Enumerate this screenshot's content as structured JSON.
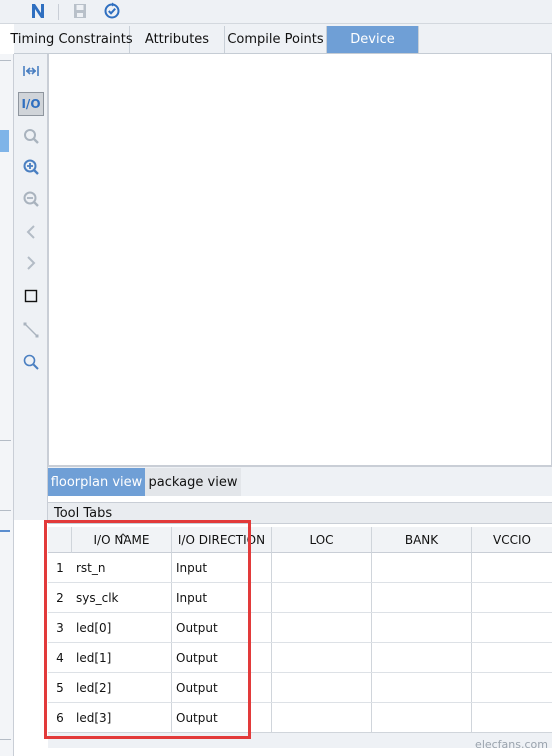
{
  "toolbar": {
    "buttons": [
      {
        "icon": "n-logo-icon"
      },
      {
        "icon": "save-icon"
      },
      {
        "icon": "check-refresh-icon"
      }
    ]
  },
  "tabs": [
    {
      "label": "Timing Constraints",
      "active": false
    },
    {
      "label": "Attributes",
      "active": false
    },
    {
      "label": "Compile Points",
      "active": false
    },
    {
      "label": "Device",
      "active": true
    }
  ],
  "vtoolbar": {
    "items": [
      {
        "icon": "fit-width-icon"
      },
      {
        "icon": "io-icon",
        "label": "I/O",
        "pressed": true
      },
      {
        "icon": "zoom-area-icon"
      },
      {
        "icon": "zoom-in-icon"
      },
      {
        "icon": "zoom-out-icon"
      },
      {
        "icon": "back-icon"
      },
      {
        "icon": "forward-icon"
      },
      {
        "icon": "select-rect-icon"
      },
      {
        "icon": "route-line-icon"
      },
      {
        "icon": "search-icon"
      }
    ]
  },
  "view_tabs": [
    {
      "label": "floorplan view",
      "active": true
    },
    {
      "label": "package view",
      "active": false
    }
  ],
  "tool_tabs_label": "Tool Tabs",
  "table": {
    "columns": [
      "I/O NAME",
      "I/O DIRECTION",
      "LOC",
      "BANK",
      "VCCIO"
    ],
    "sorted_column": "I/O NAME",
    "rows": [
      {
        "num": "1",
        "name": "rst_n",
        "direction": "Input"
      },
      {
        "num": "2",
        "name": "sys_clk",
        "direction": "Input"
      },
      {
        "num": "3",
        "name": "led[0]",
        "direction": "Output"
      },
      {
        "num": "4",
        "name": "led[1]",
        "direction": "Output"
      },
      {
        "num": "5",
        "name": "led[2]",
        "direction": "Output"
      },
      {
        "num": "6",
        "name": "led[3]",
        "direction": "Output"
      }
    ]
  },
  "watermark": "elecfans.com",
  "colors": {
    "accent": "#6f9fd6",
    "highlight": "#e23a3a",
    "background": "#eef1f5"
  }
}
